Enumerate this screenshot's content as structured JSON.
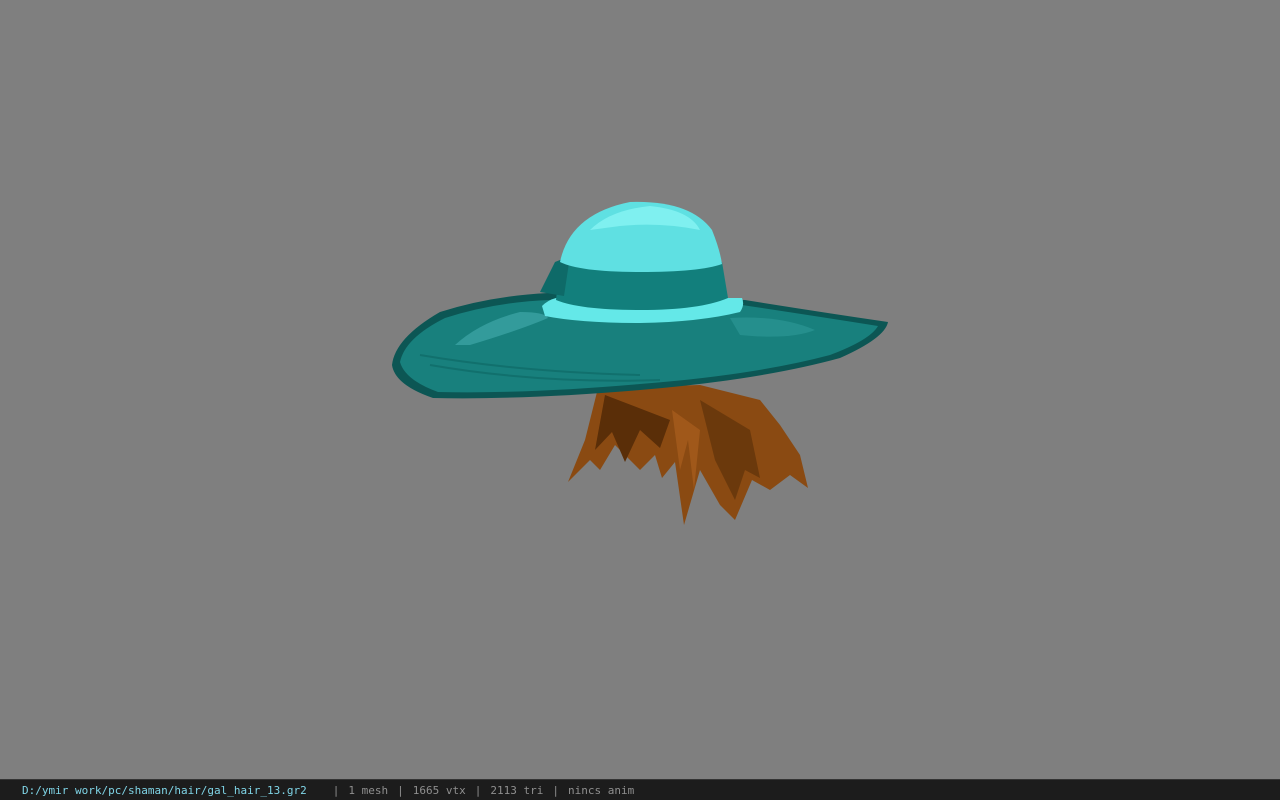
{
  "viewport": {
    "background_color": "#7f7f7f",
    "model": {
      "name": "hat-with-hair",
      "colors": {
        "crown": "#5fe0e2",
        "crown_light": "#7ff0f0",
        "band": "#127f7c",
        "band_light": "#64e8e8",
        "brim": "#18807d",
        "brim_dark": "#0c5654",
        "hair": "#8a4a12",
        "hair_dark": "#5a2e08"
      }
    }
  },
  "status_bar": {
    "file_path": "D:/ymir work/pc/shaman/hair/gal_hair_13.gr2",
    "separator": "|",
    "mesh_count": "1 mesh",
    "vertex_count": "1665 vtx",
    "triangle_count": "2113 tri",
    "anim_status": "nincs anim"
  }
}
